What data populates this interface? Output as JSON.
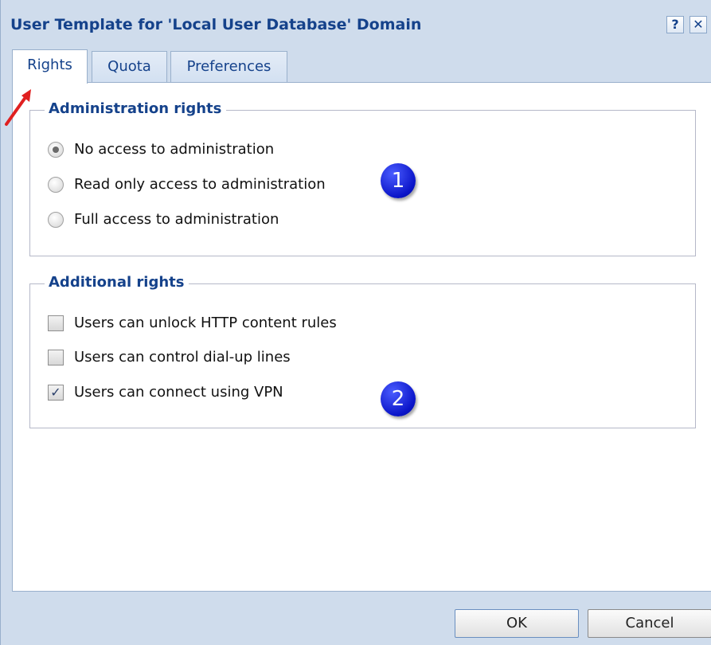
{
  "window": {
    "title": "User Template for 'Local User Database' Domain",
    "help_label": "?",
    "close_label": "✕"
  },
  "tabs": [
    {
      "label": "Rights",
      "active": true
    },
    {
      "label": "Quota",
      "active": false
    },
    {
      "label": "Preferences",
      "active": false
    }
  ],
  "administration": {
    "legend": "Administration rights",
    "options": [
      {
        "label": "No access to administration",
        "selected": true
      },
      {
        "label": "Read only access to administration",
        "selected": false
      },
      {
        "label": "Full access to administration",
        "selected": false
      }
    ]
  },
  "additional": {
    "legend": "Additional rights",
    "options": [
      {
        "label": "Users can unlock HTTP content rules",
        "checked": false
      },
      {
        "label": "Users can control dial-up lines",
        "checked": false
      },
      {
        "label": "Users can connect using VPN",
        "checked": true,
        "check_glyph": "✓"
      }
    ]
  },
  "annotations": {
    "badge_1": "1",
    "badge_2": "2",
    "arrow_color": "#e02020"
  },
  "footer": {
    "ok_label": "OK",
    "cancel_label": "Cancel"
  },
  "colors": {
    "title": "#15428b",
    "frame": "#cfdcec",
    "badge": "#0a14c8"
  }
}
